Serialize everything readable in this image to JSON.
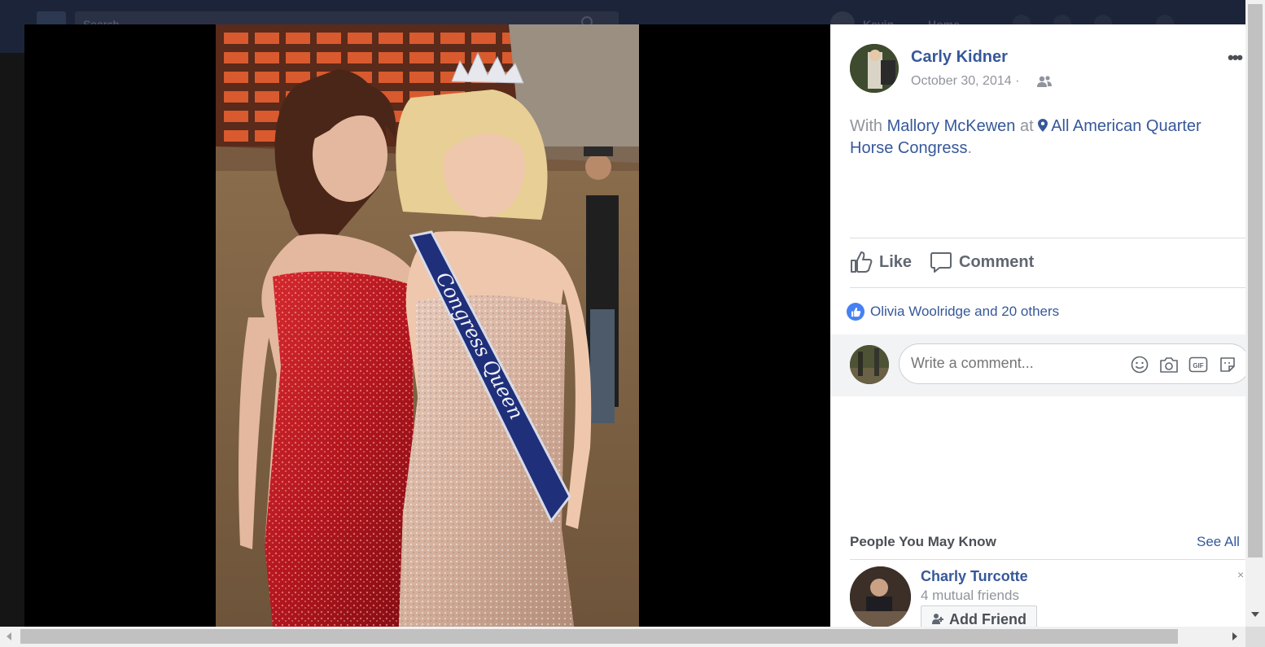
{
  "topbar": {
    "search_placeholder": "Search",
    "user_name": "Kevin",
    "home_label": "Home"
  },
  "post": {
    "author": "Carly Kidner",
    "date": "October 30, 2014",
    "date_separator": "·",
    "text_with": "With",
    "tagged_person": "Mallory McKewen",
    "text_at": "at",
    "location": "All American Quarter Horse Congress",
    "text_end": ".",
    "more_label": "•••"
  },
  "actions": {
    "like_label": "Like",
    "comment_label": "Comment"
  },
  "reactions": {
    "summary": "Olivia Woolridge and 20 others"
  },
  "comment_box": {
    "placeholder": "Write a comment..."
  },
  "photo": {
    "sash_text": "Congress Queen"
  },
  "pymk": {
    "title": "People You May Know",
    "see_all": "See All",
    "person_name": "Charly Turcotte",
    "mutual": "4 mutual friends",
    "add_friend": "Add Friend",
    "close_glyph": "×"
  },
  "colors": {
    "link": "#365899",
    "muted": "#90949c",
    "like_blue": "#4680f4",
    "dress_red": "#b3161e",
    "sash_blue": "#1f2f7a"
  }
}
